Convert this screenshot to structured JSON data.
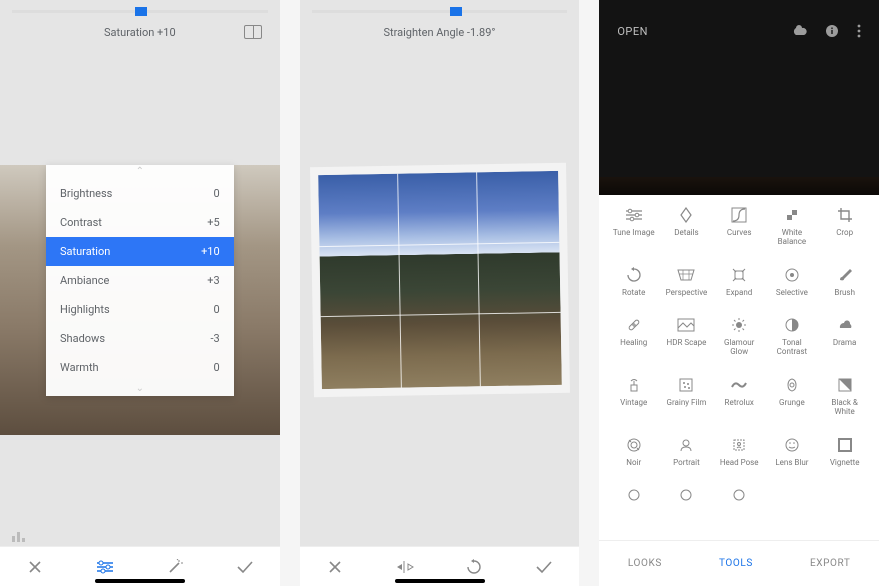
{
  "screen1": {
    "slider_label": "Saturation +10",
    "adjustments": [
      {
        "label": "Brightness",
        "value": "0"
      },
      {
        "label": "Contrast",
        "value": "+5"
      },
      {
        "label": "Saturation",
        "value": "+10"
      },
      {
        "label": "Ambiance",
        "value": "+3"
      },
      {
        "label": "Highlights",
        "value": "0"
      },
      {
        "label": "Shadows",
        "value": "-3"
      },
      {
        "label": "Warmth",
        "value": "0"
      }
    ]
  },
  "screen2": {
    "slider_label": "Straighten Angle -1.89°"
  },
  "screen3": {
    "open_label": "OPEN",
    "tools": [
      {
        "label": "Tune Image"
      },
      {
        "label": "Details"
      },
      {
        "label": "Curves"
      },
      {
        "label": "White Balance"
      },
      {
        "label": "Crop"
      },
      {
        "label": "Rotate"
      },
      {
        "label": "Perspective"
      },
      {
        "label": "Expand"
      },
      {
        "label": "Selective"
      },
      {
        "label": "Brush"
      },
      {
        "label": "Healing"
      },
      {
        "label": "HDR Scape"
      },
      {
        "label": "Glamour Glow"
      },
      {
        "label": "Tonal Contrast"
      },
      {
        "label": "Drama"
      },
      {
        "label": "Vintage"
      },
      {
        "label": "Grainy Film"
      },
      {
        "label": "Retrolux"
      },
      {
        "label": "Grunge"
      },
      {
        "label": "Black & White"
      },
      {
        "label": "Noir"
      },
      {
        "label": "Portrait"
      },
      {
        "label": "Head Pose"
      },
      {
        "label": "Lens Blur"
      },
      {
        "label": "Vignette"
      },
      {
        "label": ""
      },
      {
        "label": ""
      },
      {
        "label": ""
      }
    ],
    "tabs": {
      "looks": "LOOKS",
      "tools": "TOOLS",
      "export": "EXPORT"
    }
  },
  "accent_color": "#1a73e8"
}
